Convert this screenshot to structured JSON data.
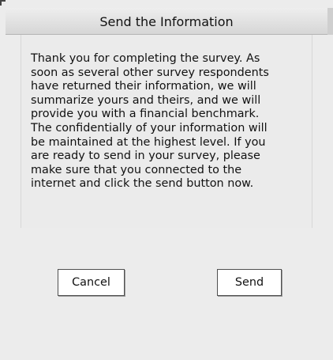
{
  "dialog": {
    "title": "Send the Information",
    "message": "Thank you for completing the survey.  As\nsoon as several other survey respondents\nhave returned their information, we will\nsummarize yours and theirs, and we will\nprovide you with a financial benchmark.\nThe confidentially of your information will\nbe maintained at the highest level.  If you\nare ready to send in your survey, please\nmake sure that you connected to the\ninternet and click the send button now."
  },
  "buttons": {
    "cancel_label": "Cancel",
    "send_label": "Send"
  }
}
